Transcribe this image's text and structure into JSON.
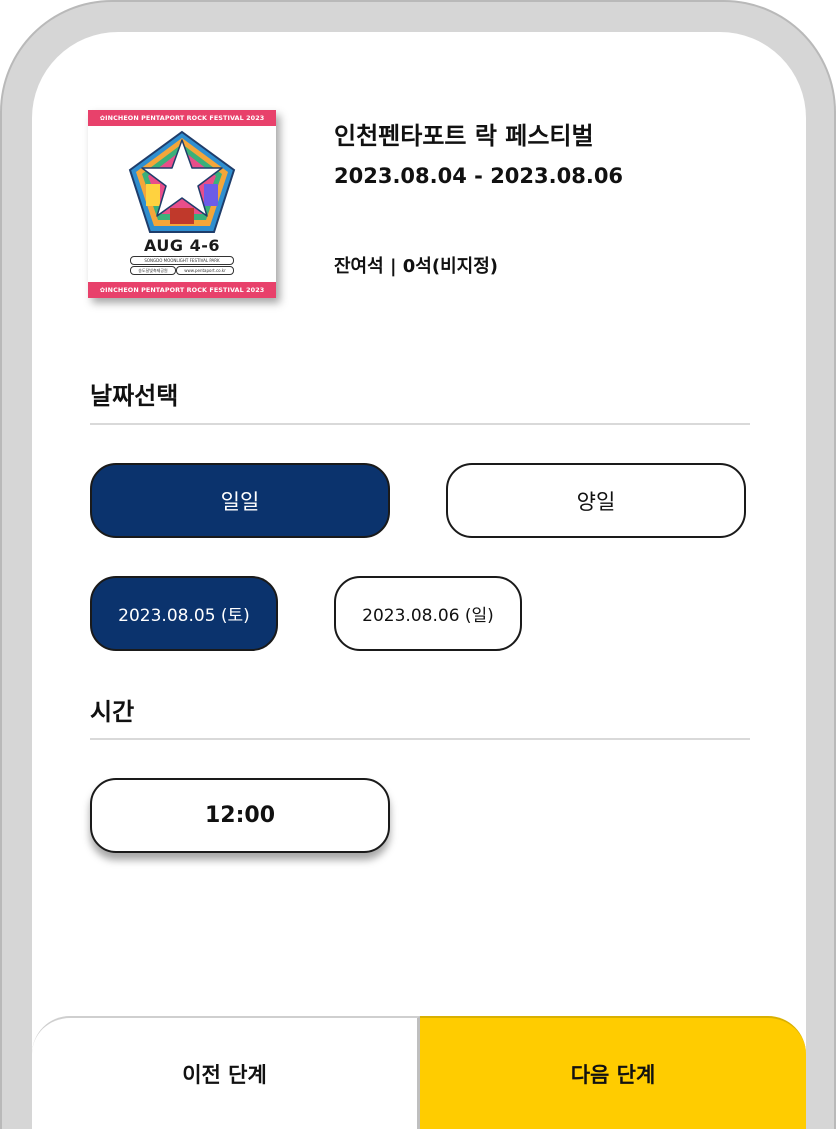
{
  "event": {
    "poster": {
      "band_text": "✿INCHEON PENTAPORT ROCK FESTIVAL 2023",
      "date_text": "AUG 4-6",
      "venue_text": "SONGDO MOONLIGHT FESTIVAL PARK",
      "korean_venue": "송도달빛축제공원",
      "url_text": "www.pentaport.co.kr"
    },
    "title": "인천펜타포트 락 페스티벌",
    "dates": "2023.08.04 - 2023.08.06",
    "seats": "잔여석 | 0석(비지정)"
  },
  "date_section": {
    "title": "날짜선택",
    "ticket_types": [
      {
        "label": "일일",
        "selected": true
      },
      {
        "label": "양일",
        "selected": false
      }
    ],
    "dates": [
      {
        "label": "2023.08.05 (토)",
        "selected": true
      },
      {
        "label": "2023.08.06 (일)",
        "selected": false
      }
    ]
  },
  "time_section": {
    "title": "시간",
    "times": [
      {
        "label": "12:00",
        "selected": false
      }
    ]
  },
  "nav": {
    "prev_label": "이전 단계",
    "next_label": "다음 단계"
  },
  "colors": {
    "selected": "#0b336d",
    "next_button": "#ffcc00",
    "poster_band": "#e8416b"
  },
  "icons": {
    "poster_logo": "star-pentagon-logo"
  }
}
